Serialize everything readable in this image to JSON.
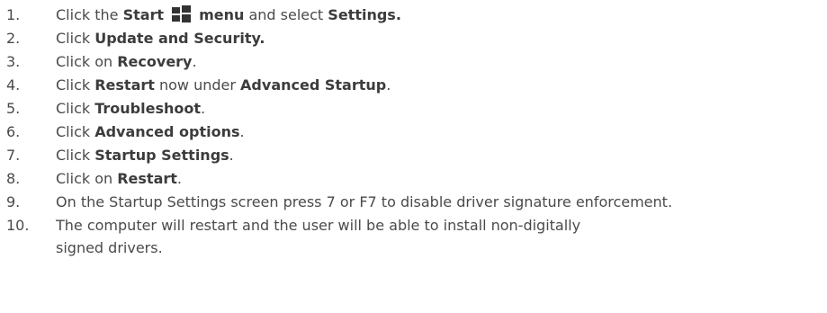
{
  "steps": [
    {
      "num": "1.",
      "parts": [
        "Click the ",
        "Start",
        "menu",
        " and select ",
        "Settings."
      ]
    },
    {
      "num": "2.",
      "parts": [
        "Click ",
        "Update and Security."
      ]
    },
    {
      "num": "3.",
      "parts": [
        "Click on ",
        "Recovery",
        "."
      ]
    },
    {
      "num": "4.",
      "parts": [
        "Click ",
        "Restart",
        " now under ",
        "Advanced Startup",
        "."
      ]
    },
    {
      "num": "5.",
      "parts": [
        "Click ",
        "Troubleshoot",
        "."
      ]
    },
    {
      "num": "6.",
      "parts": [
        "Click ",
        "Advanced options",
        "."
      ]
    },
    {
      "num": "7.",
      "parts": [
        "Click ",
        "Startup Settings",
        "."
      ]
    },
    {
      "num": "8.",
      "parts": [
        "Click on ",
        "Restart",
        "."
      ]
    },
    {
      "num": "9.",
      "parts": [
        "On the Startup Settings screen press 7 or F7 to disable driver signature enforcement."
      ]
    },
    {
      "num": "10.",
      "parts": [
        "The computer will restart and the user will be able to install non-digitally signed drivers."
      ]
    }
  ],
  "icons": {
    "start_menu": "windows-logo-icon"
  }
}
